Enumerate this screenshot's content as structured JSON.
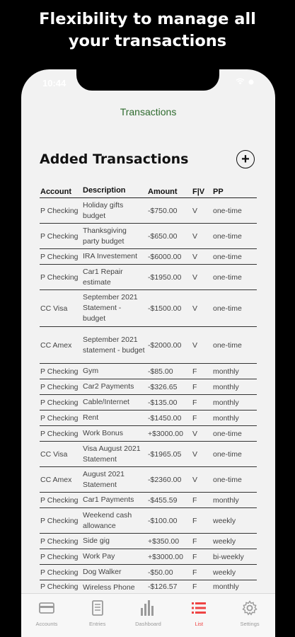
{
  "promo": {
    "line1": "Flexibility to manage all",
    "line2": "your transactions"
  },
  "status": {
    "time": "10:44"
  },
  "nav": {
    "title": "Transactions"
  },
  "section": {
    "title": "Added Transactions",
    "add_icon": "plus-circle-icon"
  },
  "table": {
    "headers": [
      "Account",
      "Description",
      "Amount",
      "F|V",
      "PP"
    ],
    "rows": [
      {
        "account": "P Checking",
        "description": "Holiday gifts budget",
        "amount": "-$750.00",
        "fv": "V",
        "pp": "one-time"
      },
      {
        "account": "P Checking",
        "description": "Thanksgiving party budget",
        "amount": "-$650.00",
        "fv": "V",
        "pp": "one-time"
      },
      {
        "account": "P Checking",
        "description": "IRA Investement",
        "amount": "-$6000.00",
        "fv": "V",
        "pp": "one-time"
      },
      {
        "account": "P Checking",
        "description": "Car1 Repair estimate",
        "amount": "-$1950.00",
        "fv": "V",
        "pp": "one-time"
      },
      {
        "account": "CC Visa",
        "description": "September 2021 Statement - budget",
        "amount": "-$1500.00",
        "fv": "V",
        "pp": "one-time"
      },
      {
        "account": "CC Amex",
        "description": "September 2021 statement - budget",
        "amount": "-$2000.00",
        "fv": "V",
        "pp": "one-time"
      },
      {
        "account": "P Checking",
        "description": "Gym",
        "amount": "-$85.00",
        "fv": "F",
        "pp": "monthly"
      },
      {
        "account": "P Checking",
        "description": "Car2 Payments",
        "amount": "-$326.65",
        "fv": "F",
        "pp": "monthly"
      },
      {
        "account": "P Checking",
        "description": "Cable/Internet",
        "amount": "-$135.00",
        "fv": "F",
        "pp": "monthly"
      },
      {
        "account": "P Checking",
        "description": "Rent",
        "amount": "-$1450.00",
        "fv": "F",
        "pp": "monthly"
      },
      {
        "account": "P Checking",
        "description": "Work Bonus",
        "amount": "+$3000.00",
        "fv": "V",
        "pp": "one-time"
      },
      {
        "account": "CC Visa",
        "description": "Visa August 2021 Statement",
        "amount": "-$1965.05",
        "fv": "V",
        "pp": "one-time"
      },
      {
        "account": "CC Amex",
        "description": "August 2021 Statement",
        "amount": "-$2360.00",
        "fv": "V",
        "pp": "one-time"
      },
      {
        "account": "P Checking",
        "description": "Car1 Payments",
        "amount": "-$455.59",
        "fv": "F",
        "pp": "monthly"
      },
      {
        "account": "P Checking",
        "description": "Weekend cash allowance",
        "amount": "-$100.00",
        "fv": "F",
        "pp": "weekly"
      },
      {
        "account": "P Checking",
        "description": "Side gig",
        "amount": "+$350.00",
        "fv": "F",
        "pp": "weekly"
      },
      {
        "account": "P Checking",
        "description": "Work Pay",
        "amount": "+$3000.00",
        "fv": "F",
        "pp": "bi-weekly"
      },
      {
        "account": "P Checking",
        "description": "Dog Walker",
        "amount": "-$50.00",
        "fv": "F",
        "pp": "weekly"
      },
      {
        "account": "P Checking",
        "description": "Wireless Phone",
        "amount": "-$126.57",
        "fv": "F",
        "pp": "monthly"
      }
    ]
  },
  "tabbar": {
    "items": [
      {
        "label": "Accounts",
        "icon": "wallet-icon",
        "active": false
      },
      {
        "label": "Entries",
        "icon": "document-icon",
        "active": false
      },
      {
        "label": "Dashboard",
        "icon": "bar-chart-icon",
        "active": false
      },
      {
        "label": "List",
        "icon": "list-icon",
        "active": true
      },
      {
        "label": "Settings",
        "icon": "gear-icon",
        "active": false
      }
    ],
    "active_color": "#ee4444",
    "inactive_color": "#9a9a9a"
  }
}
